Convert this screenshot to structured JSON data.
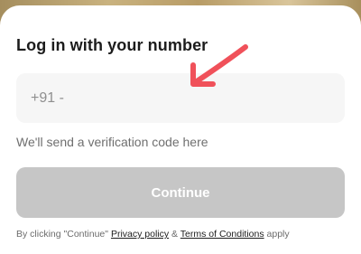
{
  "login": {
    "title": "Log in with your number",
    "phone_placeholder": "+91 -",
    "hint": "We'll send a verification code here",
    "continue_label": "Continue"
  },
  "terms": {
    "prefix": "By clicking \"Continue\"",
    "privacy_label": "Privacy policy",
    "joiner": "&",
    "conditions_label": "Terms of Conditions",
    "suffix": "apply"
  },
  "annotation": {
    "arrow_icon": "red-arrow-icon",
    "arrow_color": "#f0515a"
  },
  "colors": {
    "button_disabled": "#c6c6c6",
    "input_bg": "#f6f6f6"
  }
}
